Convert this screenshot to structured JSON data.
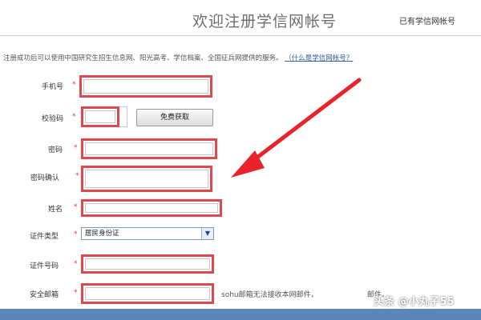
{
  "header": {
    "title": "欢迎注册学信网帐号",
    "login_link": "已有学信网帐号"
  },
  "notice": {
    "text": "注册成功后可以使用中国研究生招生信息网、阳光高考、学信档案、全国征兵网提供的服务。",
    "link_text": "（什么是学信网帐号？"
  },
  "form": {
    "phone_label": "手机号",
    "code_label": "校验码",
    "get_code_button": "免费获取",
    "password_label": "密码",
    "confirm_label": "密码确认",
    "name_label": "姓名",
    "id_type_label": "证件类型",
    "id_type_value": "居民身份证",
    "id_number_label": "证件号码",
    "email_label": "安全邮箱",
    "required_mark": "*",
    "email_hint": "sohu邮箱无法接收本网邮件，",
    "email_hint_tail": "邮件。"
  },
  "watermark": "头条 @小丸子55",
  "colors": {
    "highlight": "#e0474f",
    "arrow": "#e8232b",
    "bottom_bar": "#5a86b8"
  }
}
